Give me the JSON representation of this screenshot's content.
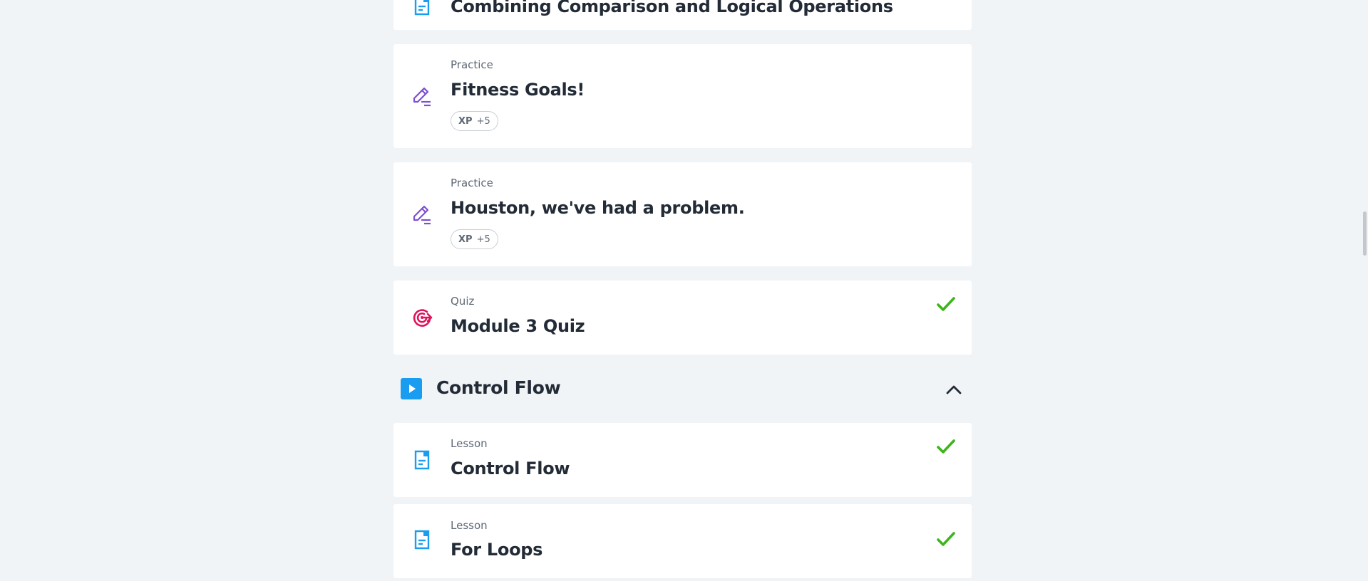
{
  "modules": {
    "prev_items": [
      {
        "type": "",
        "title": "Combining Comparison and Logical Operations",
        "icon": "lesson-icon"
      },
      {
        "type": "Practice",
        "title": "Fitness Goals!",
        "icon": "practice-pencil-icon",
        "xp_label": "XP",
        "xp_value": "+5"
      },
      {
        "type": "Practice",
        "title": "Houston, we've had a problem.",
        "icon": "practice-pencil-icon",
        "xp_label": "XP",
        "xp_value": "+5"
      },
      {
        "type": "Quiz",
        "title": "Module 3 Quiz",
        "icon": "quiz-target-icon",
        "completed": true
      }
    ],
    "section": {
      "title": "Control Flow",
      "icon": "play-icon",
      "toggle_icon": "chevron-up-icon"
    },
    "section_items": [
      {
        "type": "Lesson",
        "title": "Control Flow",
        "icon": "lesson-icon",
        "completed": true
      },
      {
        "type": "Lesson",
        "title": "For Loops",
        "icon": "lesson-icon",
        "completed": true
      }
    ]
  },
  "colors": {
    "background": "#f1f4f7",
    "lesson_blue": "#1a9cf0",
    "practice_purple": "#7e4fd1",
    "quiz_pink": "#e0135c",
    "check_green": "#3eb51b"
  }
}
